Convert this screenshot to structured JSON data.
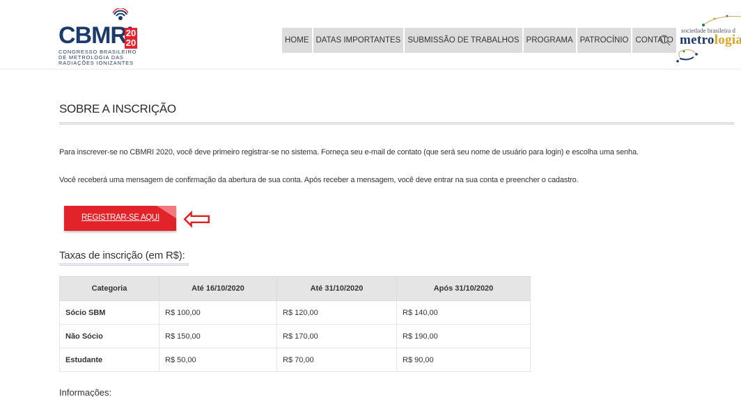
{
  "header": {
    "logo": {
      "word": "CBMRI",
      "year": "20\n20",
      "subtitle": "CONGRESSO BRASILEIRO\nDE METROLOGIA DAS\nRADIAÇÕES IONIZANTES"
    },
    "nav": [
      {
        "label": "HOME"
      },
      {
        "label": "DATAS IMPORTANTES"
      },
      {
        "label": "SUBMISSÃO DE TRABALHOS"
      },
      {
        "label": "PROGRAMA"
      },
      {
        "label": "PATROCÍNIO"
      },
      {
        "label": "CONTATO"
      }
    ],
    "partner": {
      "small": "sociedade brasileira d",
      "big_main": "metro",
      "big_accent": "logia"
    }
  },
  "main": {
    "title": "SOBRE A INSCRIÇÃO",
    "para1": "Para inscrever-se no CBMRI 2020, você deve primeiro registrar-se no sistema. Forneça seu e-mail de contato (que será seu nome de usuário para login) e escolha uma senha.",
    "para2": "Você receberá uma mensagem de confirmação da abertura de sua conta. Após receber a mensagem, você deve entrar na sua conta e preencher o cadastro.",
    "register_label": "REGISTRAR-SE AQUI",
    "arrow_glyph": "⇦",
    "fees_title": "Taxas de inscrição (em R$):",
    "fees_table": {
      "headers": [
        "Categoria",
        "Até 16/10/2020",
        "Até 31/10/2020",
        "Após 31/10/2020"
      ],
      "rows": [
        [
          "Sócio SBM",
          "R$ 100,00",
          "R$ 120,00",
          "R$ 140,00"
        ],
        [
          "Não Sócio",
          "R$ 150,00",
          "R$ 170,00",
          "R$ 190,00"
        ],
        [
          "Estudante",
          "R$ 50,00",
          "R$ 70,00",
          "R$ 90,00"
        ]
      ]
    },
    "info_title": "Informações:"
  },
  "colors": {
    "brand_blue": "#1b3a6b",
    "accent_red": "#e3232a",
    "arrow_red": "#e01e1e",
    "nav_bg": "#dcdcdc"
  },
  "icons": [
    "radiation-logo-icon",
    "search-icon",
    "arrow-left-icon"
  ]
}
